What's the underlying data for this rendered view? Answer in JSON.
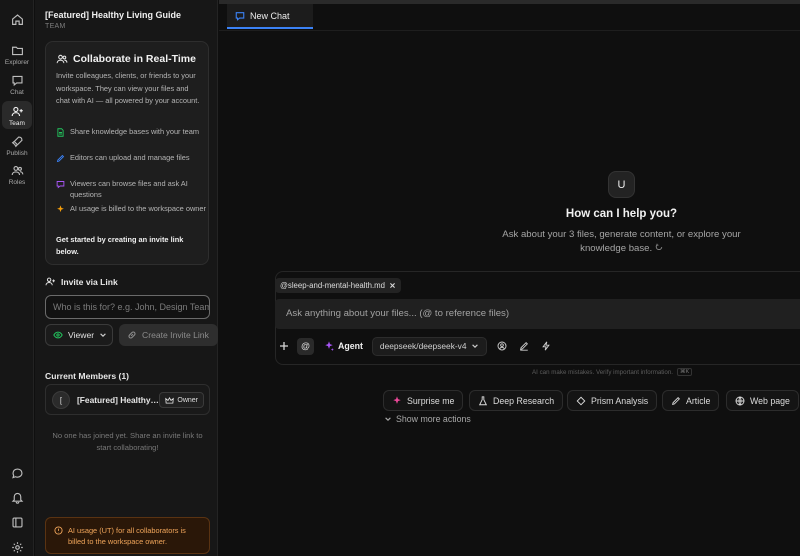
{
  "rail": {
    "items": [
      {
        "label": "",
        "icon": "home-icon"
      },
      {
        "label": "Explorer",
        "icon": "folder-icon"
      },
      {
        "label": "Chat",
        "icon": "chat-icon"
      },
      {
        "label": "Team",
        "icon": "team-icon",
        "active": true
      },
      {
        "label": "Publish",
        "icon": "rocket-icon"
      },
      {
        "label": "Roles",
        "icon": "roles-icon"
      }
    ],
    "bottom_icons": [
      "message-icon",
      "bell-icon",
      "sidebar-toggle-icon",
      "settings-icon"
    ]
  },
  "panel": {
    "workspace_title": "[Featured] Healthy Living Guide",
    "workspace_subtitle": "TEAM",
    "collab": {
      "title": "Collaborate in Real-Time",
      "description": "Invite colleagues, clients, or friends to your workspace. They can view your files and chat with AI — all powered by your account.",
      "features": [
        {
          "text": "Share knowledge bases with your team",
          "color": "#22c55e"
        },
        {
          "text": "Editors can upload and manage files",
          "color": "#3b82f6"
        },
        {
          "text": "Viewers can browse files and ask AI questions",
          "color": "#a855f7"
        },
        {
          "text": "AI usage is billed to the workspace owner",
          "color": "#f59e0b"
        }
      ],
      "cta": "Get started by creating an invite link below."
    },
    "invite": {
      "title": "Invite via Link",
      "placeholder": "Who is this for? e.g. John, Design Team",
      "role_value": "Viewer",
      "create_label": "Create Invite Link"
    },
    "members": {
      "title": "Current Members (1)",
      "list": [
        {
          "avatar": "[",
          "name": "[Featured] Healthy Living Guide",
          "badge": "Owner"
        }
      ],
      "empty_note": "No one has joined yet. Share an invite link to start collaborating!"
    },
    "billing_note": "AI usage (UT) for all collaborators is billed to the workspace owner."
  },
  "main": {
    "tab_label": "New Chat",
    "avatar_letter": "U",
    "help_title": "How can I help you?",
    "help_subtitle": "Ask about your 3 files, generate content, or explore your knowledge base.",
    "file_chip": "@sleep-and-mental-health.md",
    "composer_placeholder": "Ask anything about your files... (@ to reference files)",
    "at_label": "@",
    "agent_label": "Agent",
    "model_value": "deepseek/deepseek-v4",
    "disclaimer": "AI can make mistakes. Verify important information.",
    "disclaimer_kbd": "⌘K",
    "actions": [
      {
        "label": "Surprise me",
        "icon": "sparkle-icon",
        "accent": "#ec4899"
      },
      {
        "label": "Deep Research",
        "icon": "flask-icon"
      },
      {
        "label": "Prism Analysis",
        "icon": "prism-icon"
      },
      {
        "label": "Article",
        "icon": "pencil-icon"
      },
      {
        "label": "Web page",
        "icon": "globe-icon"
      }
    ],
    "show_more": "Show more actions"
  },
  "colors": {
    "accent_blue": "#3b82f6",
    "warning": "#f0a55a",
    "surprise_pink": "#ec4899"
  }
}
